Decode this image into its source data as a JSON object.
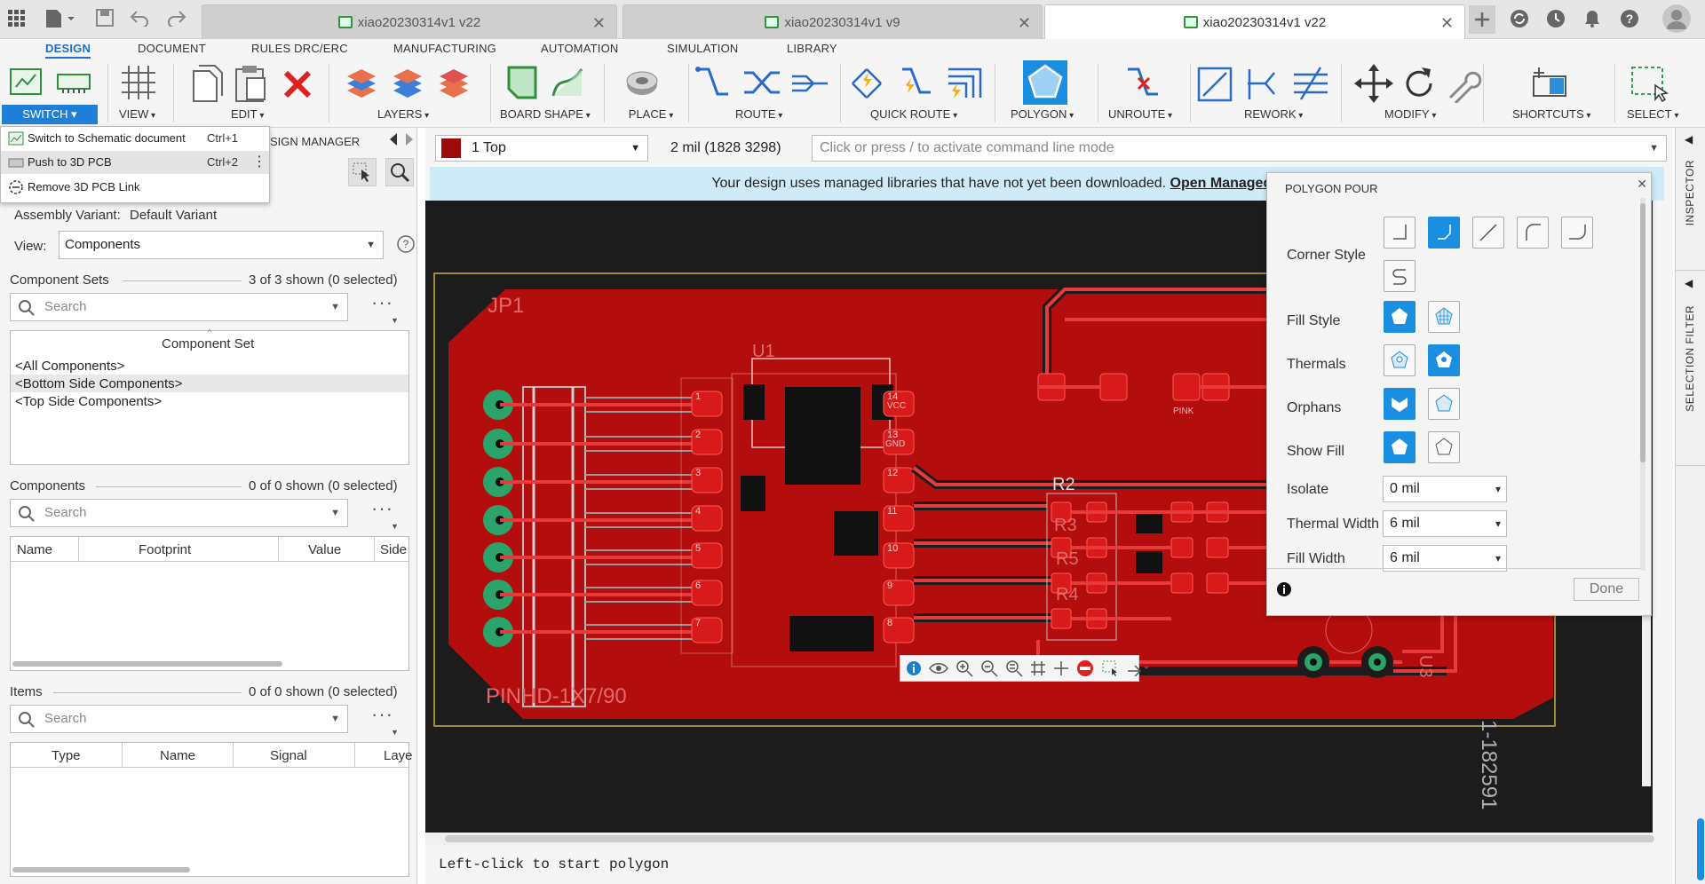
{
  "window": {
    "tabs": [
      {
        "label": "xiao20230314v1 v22"
      },
      {
        "label": "xiao20230314v1 v9"
      },
      {
        "label": "xiao20230314v1 v22"
      }
    ]
  },
  "ribbon": {
    "tabs": [
      "DESIGN",
      "DOCUMENT",
      "RULES DRC/ERC",
      "MANUFACTURING",
      "AUTOMATION",
      "SIMULATION",
      "LIBRARY"
    ],
    "groups": {
      "switch": "SWITCH",
      "view": "VIEW",
      "edit": "EDIT",
      "layers": "LAYERS",
      "board_shape": "BOARD SHAPE",
      "place": "PLACE",
      "route": "ROUTE",
      "quick_route": "QUICK ROUTE",
      "polygon": "POLYGON",
      "unroute": "UNROUTE",
      "rework": "REWORK",
      "modify": "MODIFY",
      "shortcuts": "SHORTCUTS",
      "select": "SELECT"
    }
  },
  "switch_menu": {
    "items": [
      {
        "label": "Switch to Schematic document",
        "shortcut": "Ctrl+1"
      },
      {
        "label": "Push to 3D PCB",
        "shortcut": "Ctrl+2"
      },
      {
        "label": "Remove 3D PCB Link",
        "shortcut": ""
      }
    ]
  },
  "left_panel": {
    "title": "SIGN MANAGER",
    "assembly_variant_label": "Assembly Variant:",
    "assembly_variant_value": "Default Variant",
    "view_label": "View:",
    "view_value": "Components",
    "component_sets": {
      "title": "Component Sets",
      "count": "3 of 3 shown (0 selected)",
      "search_placeholder": "Search",
      "column": "Component Set",
      "rows": [
        "<All Components>",
        "<Bottom Side Components>",
        "<Top Side Components>"
      ]
    },
    "components": {
      "title": "Components",
      "count": "0 of 0 shown (0 selected)",
      "search_placeholder": "Search",
      "columns": [
        "Name",
        "Footprint",
        "Value",
        "Side"
      ]
    },
    "items": {
      "title": "Items",
      "count": "0 of 0 shown (0 selected)",
      "search_placeholder": "Search",
      "columns": [
        "Type",
        "Name",
        "Signal",
        "Laye"
      ]
    }
  },
  "canvas": {
    "layer": "1 Top",
    "layer_color": "#9e0a0a",
    "grid": "2 mil (1828 3298)",
    "command_placeholder": "Click or press / to activate command line mode",
    "banner_text": "Your design uses managed libraries that have not yet been downloaded.",
    "banner_link": "Open Managed Libraries to dov",
    "status": "Left-click to start polygon",
    "board_labels": {
      "jp1": "JP1",
      "pinhd": "PINHD-1X7/90",
      "u1": "U1",
      "r2": "R2",
      "r3": "R3",
      "r4": "R4",
      "r5": "R5",
      "pink": "PINK",
      "u3": "U3",
      "side_text": "1-182591",
      "vcc": "VCC",
      "gnd": "GND"
    }
  },
  "polygon_pour": {
    "title": "POLYGON POUR",
    "corner_style": "Corner Style",
    "fill_style": "Fill Style",
    "thermals": "Thermals",
    "orphans": "Orphans",
    "show_fill": "Show Fill",
    "isolate_label": "Isolate",
    "isolate_value": "0 mil",
    "thermal_width_label": "Thermal Width",
    "thermal_width_value": "6 mil",
    "fill_width_label": "Fill Width",
    "fill_width_value": "6 mil",
    "done": "Done"
  },
  "side": {
    "inspector": "INSPECTOR",
    "selection_filter": "SELECTION FILTER"
  },
  "colors": {
    "accent": "#1f6fd1",
    "copper": "#c01010",
    "board_bg": "#1c1c1c",
    "pad_green": "#2aa468",
    "highlight": "#1a8ee0"
  }
}
